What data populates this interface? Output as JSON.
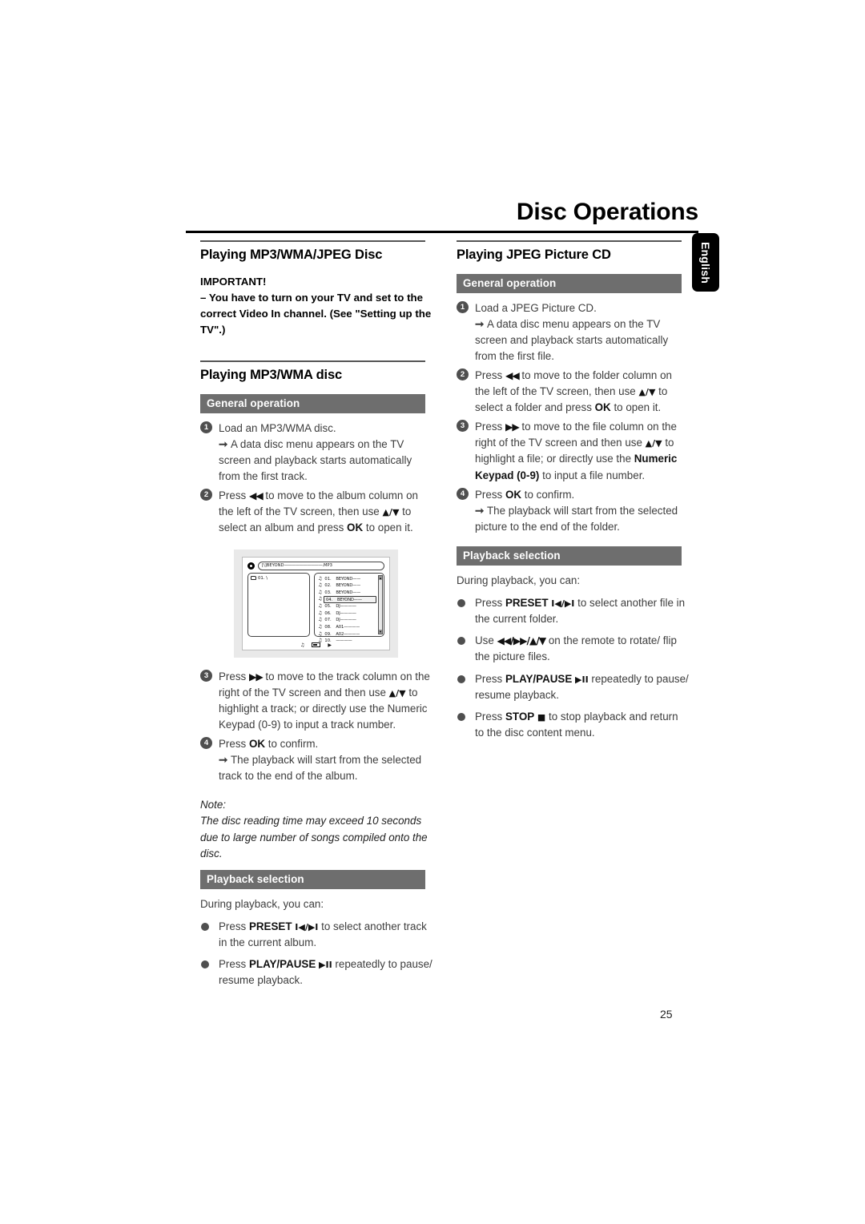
{
  "header": {
    "chapter_title": "Disc Operations",
    "side_tab_label": "English"
  },
  "left_column": {
    "section1_title": "Playing MP3/WMA/JPEG Disc",
    "important": {
      "heading": "IMPORTANT!",
      "body": "–  You have to turn on your TV and set to the correct Video In channel. (See \"Setting up the TV\".)"
    },
    "section2_title": "Playing MP3/WMA disc",
    "general_operation_bar": "General operation",
    "steps": [
      {
        "num": "1",
        "text": "Load an MP3/WMA disc.",
        "arrow": "A data disc menu appears on the TV screen and playback starts automatically from the first track."
      },
      {
        "num": "2",
        "text_parts": [
          "Press ",
          "◀◀",
          " to move to the album column on the left of the TV screen, then use ",
          "▲/▼",
          " to select an album and press ",
          "OK",
          " to open it."
        ]
      },
      {
        "num": "3",
        "text_parts": [
          "Press ",
          "▶▶",
          " to move to the track column on the right of the TV screen and then use ",
          "▲/▼",
          " to highlight a track; or directly use the Numeric Keypad (0-9) to input a track number."
        ]
      },
      {
        "num": "4",
        "text_parts": [
          "Press ",
          "OK",
          " to confirm."
        ],
        "arrow": "The playback will start from the selected track to the end of the album."
      }
    ],
    "note": {
      "label": "Note:",
      "text": "The disc reading time may exceed 10 seconds due to large number of songs compiled onto the disc."
    },
    "playback_selection_bar": "Playback selection",
    "playback_intro": "During playback, you can:",
    "bullets": [
      {
        "pre": "Press ",
        "bold": "PRESET",
        "sym": "I◀/▶I",
        "post": " to select another track in the current album."
      },
      {
        "pre": "Press ",
        "bold": "PLAY/PAUSE",
        "sym": "▶II",
        "post": " repeatedly to pause/ resume playback."
      }
    ]
  },
  "right_column": {
    "section_title": "Playing JPEG Picture CD",
    "general_operation_bar": "General operation",
    "steps": [
      {
        "num": "1",
        "text": "Load a JPEG Picture CD.",
        "arrow": "A data disc menu appears on the TV screen and playback starts automatically from the first file."
      },
      {
        "num": "2",
        "text_parts": [
          "Press ",
          "◀◀",
          " to move to the folder column on the left of the TV screen, then use ",
          "▲/▼",
          " to select a folder and press ",
          "OK",
          " to open it."
        ]
      },
      {
        "num": "3",
        "text_parts": [
          "Press ",
          "▶▶",
          " to move to the file column on the right of the TV screen and then use ",
          "▲/▼",
          " to highlight a file; or directly use the ",
          "Numeric Keypad (0-9)",
          " to input a file number."
        ]
      },
      {
        "num": "4",
        "text_parts": [
          "Press ",
          "OK",
          " to confirm."
        ],
        "arrow": "The playback will start from the selected picture to the end of the folder."
      }
    ],
    "playback_selection_bar": "Playback selection",
    "playback_intro": "During playback, you can:",
    "bullets": [
      {
        "pre": "Press ",
        "bold": "PRESET",
        "sym": "I◀/▶I",
        "post": " to select another file in the current folder."
      },
      {
        "pre": "Use ",
        "bold": "",
        "sym": "◀◀/▶▶/▲/▼",
        "post": " on the remote to rotate/ flip the picture files."
      },
      {
        "pre": "Press ",
        "bold": "PLAY/PAUSE",
        "sym": "▶II",
        "post": " repeatedly to pause/ resume playback."
      },
      {
        "pre": "Press ",
        "bold": "STOP",
        "sym": "■",
        "post": " to stop playback and return to the disc content menu."
      }
    ]
  },
  "tv_screen": {
    "path_label": "[\\]BEYOND",
    "path_dots": "——————————",
    "path_ext": ".MP3",
    "folder_entry": "01.  \\",
    "tracks": [
      {
        "num": "01.",
        "name": "BEYOND——"
      },
      {
        "num": "02.",
        "name": "BEYOND——"
      },
      {
        "num": "03.",
        "name": "BEYOND——"
      },
      {
        "num": "04.",
        "name": "BEYOND——"
      },
      {
        "num": "05.",
        "name": "DJ————"
      },
      {
        "num": "06.",
        "name": "DJ————"
      },
      {
        "num": "07.",
        "name": "DJ————"
      },
      {
        "num": "08.",
        "name": "A01————"
      },
      {
        "num": "09.",
        "name": "A02————"
      },
      {
        "num": "10.",
        "name": "————"
      }
    ],
    "selected_index": 3,
    "footer_icons": [
      "music-note",
      "battery",
      "play"
    ]
  },
  "footer": {
    "page_number": "25"
  }
}
